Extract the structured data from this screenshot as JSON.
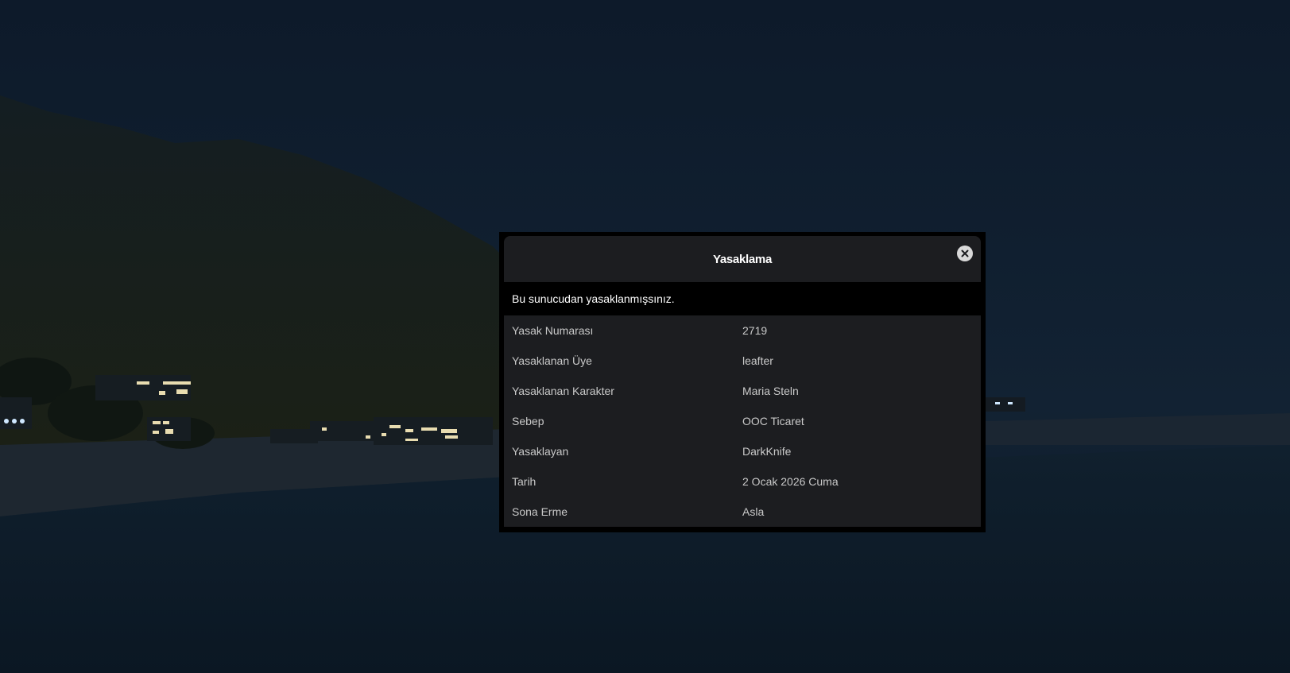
{
  "modal": {
    "title": "Yasaklama",
    "message": "Bu sunucudan yasaklanmışsınız.",
    "close_icon": "close-circle-icon",
    "details": [
      {
        "label": "Yasak Numarası",
        "value": "2719"
      },
      {
        "label": "Yasaklanan Üye",
        "value": "leafter"
      },
      {
        "label": "Yasaklanan Karakter",
        "value": "Maria Steln"
      },
      {
        "label": "Sebep",
        "value": "OOC Ticaret"
      },
      {
        "label": "Yasaklayan",
        "value": "DarkKnife"
      },
      {
        "label": "Tarih",
        "value": "2 Ocak 2026 Cuma"
      },
      {
        "label": "Sona Erme",
        "value": "Asla"
      }
    ]
  },
  "colors": {
    "sky": "#0f1f30",
    "modal_bg": "#000000",
    "panel_bg": "#1c1d20",
    "text": "#c9c9c9"
  }
}
